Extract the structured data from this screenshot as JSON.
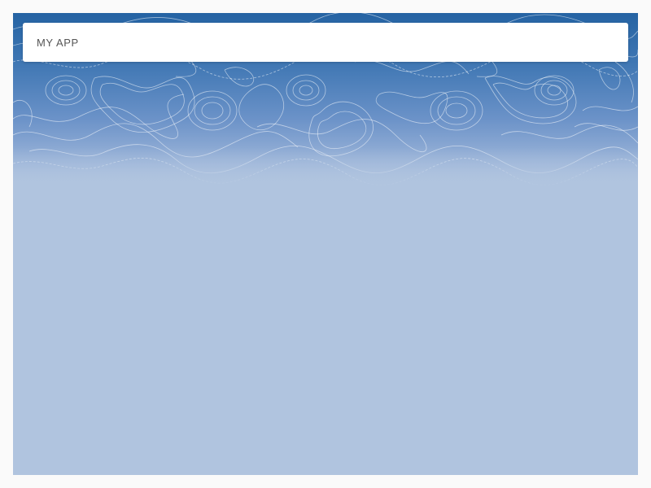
{
  "app": {
    "title": "MY APP"
  },
  "colors": {
    "page_background": "#fafafa",
    "hero_top": "#2563a3",
    "hero_bottom": "#b0c4df",
    "content_background": "#b0c4df",
    "appbar_background": "#ffffff",
    "title_text": "#555555"
  },
  "hero": {
    "pattern": "topographic-contour-lines"
  }
}
